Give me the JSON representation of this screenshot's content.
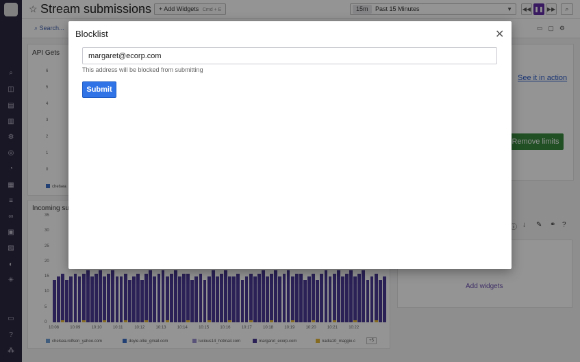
{
  "header": {
    "title": "Stream submissions",
    "add_widgets": "Add Widgets",
    "add_widgets_shortcut": "Cmd + E",
    "time_badge": "15m",
    "time_label": "Past 15 Minutes"
  },
  "subbar": {
    "search_label": "Search..."
  },
  "widgets": {
    "api_gets": {
      "title": "API Gets",
      "y_ticks": [
        "6",
        "5",
        "4",
        "3",
        "2",
        "1",
        "0"
      ],
      "legend": "chelsea"
    },
    "incoming": {
      "title": "Incoming su",
      "y_ticks": [
        "35",
        "30",
        "25",
        "20",
        "15",
        "10",
        "5",
        "0"
      ],
      "x_ticks": [
        "10:08",
        "10:09",
        "10:10",
        "10:11",
        "10:12",
        "10:13",
        "10:14",
        "10:15",
        "10:16",
        "10:17",
        "10:18",
        "10:19",
        "10:20",
        "10:21",
        "10:22"
      ],
      "legend": [
        {
          "label": "chelsea.rolfson_yahoo.com",
          "color": "#6fa0d8"
        },
        {
          "label": "doyle.ollie_gmail.com",
          "color": "#3b6fc9"
        },
        {
          "label": "lucious14_hotmail.com",
          "color": "#9a8fd0"
        },
        {
          "label": "margaret_ecorp.com",
          "color": "#4b3a96"
        },
        {
          "label": "nadia10_maggio.c",
          "color": "#e6b73a"
        }
      ],
      "more": "+5"
    },
    "see_action": "See it in action",
    "remove_limits": "Remove limits",
    "add_widgets_link": "Add widgets"
  },
  "modal": {
    "title": "Blocklist",
    "email_value": "margaret@ecorp.com",
    "helper_text": "This address will be blocked from submitting",
    "submit_label": "Submit"
  },
  "colors": {
    "nav_bg": "#2b2640",
    "accent_purple": "#632ca6",
    "submit_blue": "#2f73e6",
    "remove_green": "#3a8a3f"
  },
  "chart_data": {
    "type": "bar",
    "categories": [
      "10:08",
      "10:09",
      "10:10",
      "10:11",
      "10:12",
      "10:13",
      "10:14",
      "10:15",
      "10:16",
      "10:17",
      "10:18",
      "10:19",
      "10:20",
      "10:21",
      "10:22"
    ],
    "series": [
      {
        "name": "margaret_ecorp.com",
        "values": [
          15,
          16,
          16,
          15,
          16,
          16,
          15,
          16,
          15,
          16,
          16,
          15,
          16,
          16,
          15
        ]
      }
    ],
    "ylim": [
      0,
      35
    ]
  }
}
